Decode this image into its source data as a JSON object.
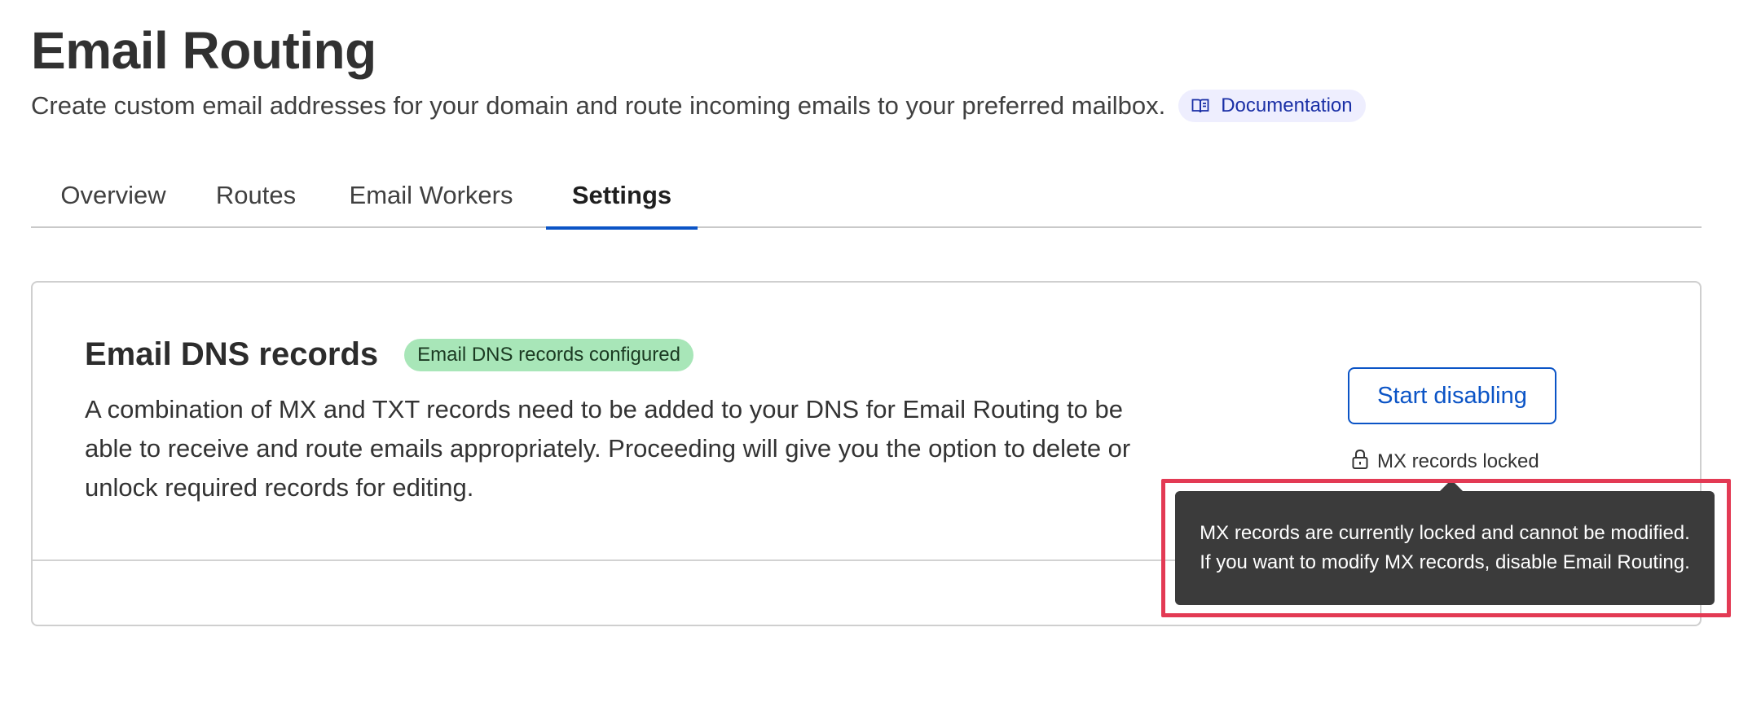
{
  "header": {
    "title": "Email Routing",
    "subtitle": "Create custom email addresses for your domain and route incoming emails to your preferred mailbox.",
    "documentation_label": "Documentation",
    "documentation_icon": "book-icon"
  },
  "tabs": [
    {
      "label": "Overview",
      "active": false
    },
    {
      "label": "Routes",
      "active": false
    },
    {
      "label": "Email Workers",
      "active": false
    },
    {
      "label": "Settings",
      "active": true
    }
  ],
  "dns_card": {
    "title": "Email DNS records",
    "status_badge": "Email DNS records configured",
    "description": "A combination of MX and TXT records need to be added to your DNS for Email Routing to be able to receive and route emails appropriately. Proceeding will give you the option to delete or unlock required records for editing.",
    "button_label": "Start disabling",
    "lock_status": "MX records locked",
    "lock_icon": "lock-icon"
  },
  "tooltip": {
    "text": "MX records are currently locked and cannot be modified. If you want to modify MX records, disable Email Routing."
  },
  "colors": {
    "accent": "#0b54c6",
    "badge_bg": "#a8e6b8",
    "tooltip_bg": "#3b3b3b",
    "highlight": "#e33a54",
    "doc_pill_bg": "#eeeefe"
  }
}
